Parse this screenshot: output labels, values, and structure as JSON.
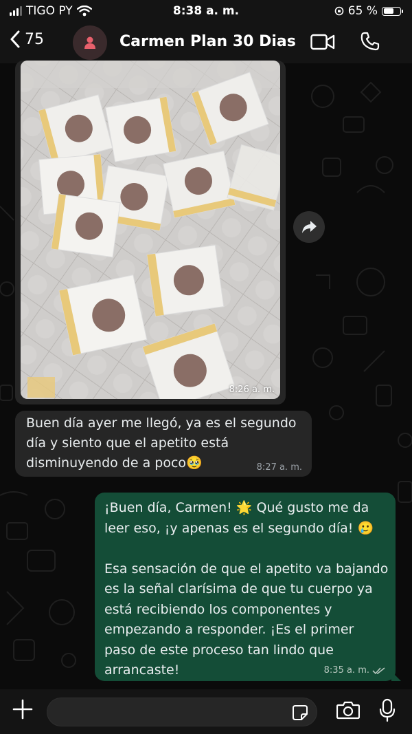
{
  "status_bar": {
    "carrier": "TIGO PY",
    "time": "8:38 a. m.",
    "battery_percent": "65 %",
    "battery_level": 0.65
  },
  "header": {
    "back_count": "75",
    "contact_name": "Carmen Plan 30 Dias",
    "icons": [
      "back-chevron-icon",
      "person-icon",
      "video-call-icon",
      "phone-icon"
    ]
  },
  "messages": [
    {
      "type": "image",
      "direction": "incoming",
      "time": "8:26 a. m."
    },
    {
      "type": "text",
      "direction": "incoming",
      "text": "Buen día ayer me llegó, ya es el segundo día y siento que el apetito está disminuyendo de a poco🥹",
      "time": "8:27 a. m."
    },
    {
      "type": "text",
      "direction": "outgoing",
      "text": "¡Buen día, Carmen! 🌟 Qué gusto me da leer eso, ¡y apenas es el segundo día! 🥲\n\nEsa sensación de que el apetito va bajando es la señal clarísima de que tu cuerpo ya está recibiendo los componentes y empezando a responder. ¡Es el primer paso de este proceso tan lindo que arrancaste!",
      "time": "8:35 a. m.",
      "status_icon": "double-check-icon"
    }
  ],
  "composer": {
    "value": "",
    "icons": [
      "plus-icon",
      "sticker-icon",
      "camera-icon",
      "microphone-icon"
    ]
  },
  "colors": {
    "background": "#0b0b0b",
    "bar": "#141414",
    "incoming_bubble": "#262626",
    "outgoing_bubble": "#144d37",
    "avatar_accent": "#e8606c"
  }
}
